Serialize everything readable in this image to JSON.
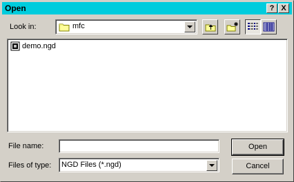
{
  "window": {
    "title": "Open",
    "help_glyph": "?",
    "close_glyph": "X"
  },
  "look_in": {
    "label": "Look in:",
    "value": "mfc",
    "icon": "folder-icon"
  },
  "toolbar": {
    "up_icon": "up-one-level-icon",
    "new_folder_icon": "new-folder-icon",
    "list_view_icon": "list-view-icon",
    "details_view_icon": "details-view-icon"
  },
  "files": [
    {
      "name": "demo.ngd",
      "icon": "ngd-file-icon"
    }
  ],
  "file_name": {
    "label": "File name:",
    "value": ""
  },
  "file_type": {
    "label": "Files of type:",
    "value": "NGD Files (*.ngd)"
  },
  "buttons": {
    "open": "Open",
    "cancel": "Cancel"
  },
  "colors": {
    "title_bar": "#00ccdd",
    "face": "#d4d0c8"
  }
}
